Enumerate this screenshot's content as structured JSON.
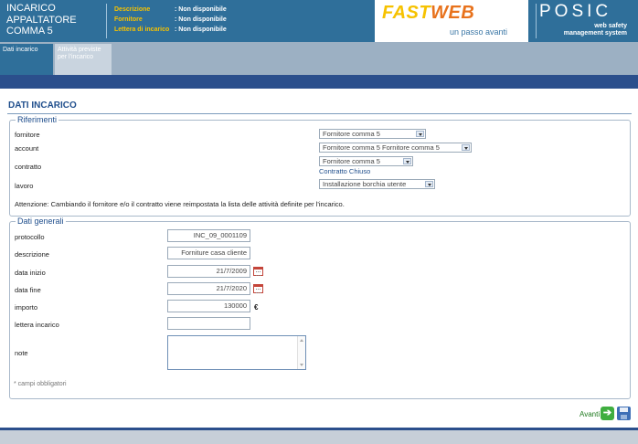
{
  "header": {
    "title_lines": [
      "INCARICO",
      "APPALTATORE",
      "COMMA 5"
    ],
    "info": [
      {
        "label": "Descrizione",
        "value": ": Non disponibile"
      },
      {
        "label": "Fornitore",
        "value": ": Non disponibile"
      },
      {
        "label": "Lettera di incarico",
        "value": ": Non disponibile"
      }
    ],
    "fastweb_logo": {
      "part1": "FAST",
      "part2": "WEB",
      "tagline": "un passo avanti"
    },
    "posic_logo": {
      "name": "POSIC",
      "sub_lines": [
        "web safety",
        "management system"
      ]
    }
  },
  "tabs": [
    {
      "label": "Dati incarico"
    },
    {
      "label": "Attività previste per l'incarico"
    }
  ],
  "page": {
    "title": "DATI INCARICO"
  },
  "riferimenti": {
    "legend": "Riferimenti",
    "fornitore": {
      "label": "fornitore",
      "value": "Fornitore comma 5"
    },
    "account": {
      "label": "account",
      "value": "Fornitore comma 5 Fornitore comma 5"
    },
    "contratto": {
      "label": "contratto",
      "value": "Fornitore comma 5",
      "link": "Contratto Chiuso"
    },
    "lavoro": {
      "label": "lavoro",
      "value": "Installazione borchia utente"
    },
    "warning": "Attenzione: Cambiando il fornitore e/o il contratto viene reimpostata la lista delle attività definite per l'incarico."
  },
  "dati_generali": {
    "legend": "Dati generali",
    "protocollo": {
      "label": "protocollo",
      "value": "INC_09_0001109"
    },
    "descrizione": {
      "label": "descrizione",
      "value": "Forniture casa cliente"
    },
    "data_inizio": {
      "label": "data inizio",
      "value": "21/7/2009"
    },
    "data_fine": {
      "label": "data fine",
      "value": "21/7/2020"
    },
    "importo": {
      "label": "importo",
      "value": "130000",
      "currency": "€"
    },
    "lettera_incarico": {
      "label": "lettera incarico",
      "value": ""
    },
    "note": {
      "label": "note",
      "value": ""
    },
    "required_note": "* campi obbligatori"
  },
  "footer": {
    "next_label": "Avanti",
    "icons": [
      "arrow-right-icon",
      "floppy-save-icon"
    ]
  },
  "colors": {
    "header_blue": "#2f6f9a",
    "nav_dark_blue": "#2b4f8c",
    "accent_yellow": "#f6c200",
    "accent_orange": "#e8721c",
    "title_blue": "#1f4e8c"
  }
}
